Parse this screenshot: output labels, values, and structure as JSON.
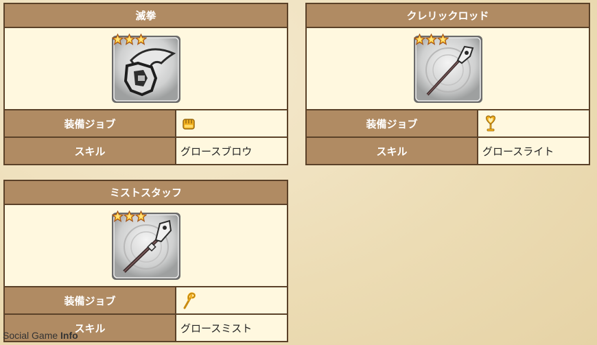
{
  "cards": [
    {
      "title": "滅拳",
      "stars": 3,
      "weapon_icon": "fist-weapon-icon",
      "rows": [
        {
          "label": "装備ジョブ",
          "icon": "monk-job-icon"
        },
        {
          "label": "スキル",
          "value": "グロースブロウ"
        }
      ]
    },
    {
      "title": "クレリックロッド",
      "stars": 3,
      "weapon_icon": "rod-weapon-icon",
      "rows": [
        {
          "label": "装備ジョブ",
          "icon": "cleric-job-icon"
        },
        {
          "label": "スキル",
          "value": "グロースライト"
        }
      ]
    },
    {
      "title": "ミストスタッフ",
      "stars": 3,
      "weapon_icon": "staff-weapon-icon",
      "rows": [
        {
          "label": "装備ジョブ",
          "icon": "mage-job-icon"
        },
        {
          "label": "スキル",
          "value": "グロースミスト"
        }
      ]
    }
  ],
  "watermark": {
    "prefix": "Social Game ",
    "suffix": "Info"
  },
  "colors": {
    "header": "#b08b63",
    "border": "#5a4128",
    "cell": "#fff8df",
    "star": "#f5a623"
  }
}
